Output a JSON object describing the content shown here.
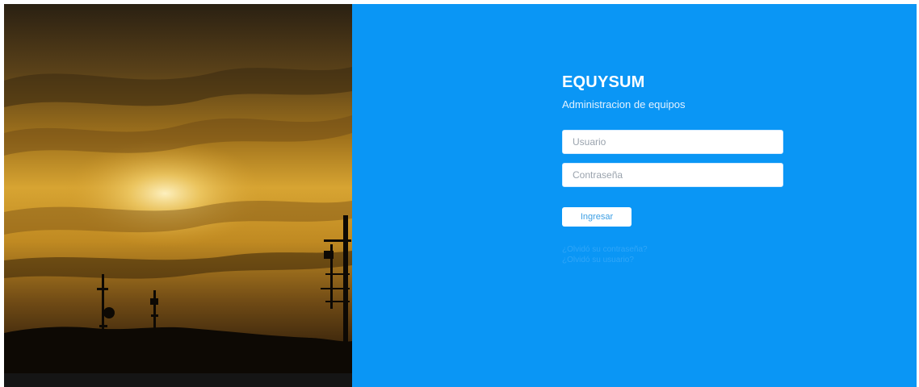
{
  "colors": {
    "panel_background": "#0a96f5",
    "button_text": "#3d9fe4",
    "link_text": "#7cc6ff"
  },
  "photo": {
    "description_icon": "sunset-antenna-photo"
  },
  "login": {
    "brand": "EQUYSUM",
    "subtitle": "Administracion de equipos",
    "username_placeholder": "Usuario",
    "password_placeholder": "Contraseña",
    "submit_label": "Ingresar",
    "forgot_password": "¿Olvidó su contraseña?",
    "forgot_username": "¿Olvidó su usuario?"
  }
}
